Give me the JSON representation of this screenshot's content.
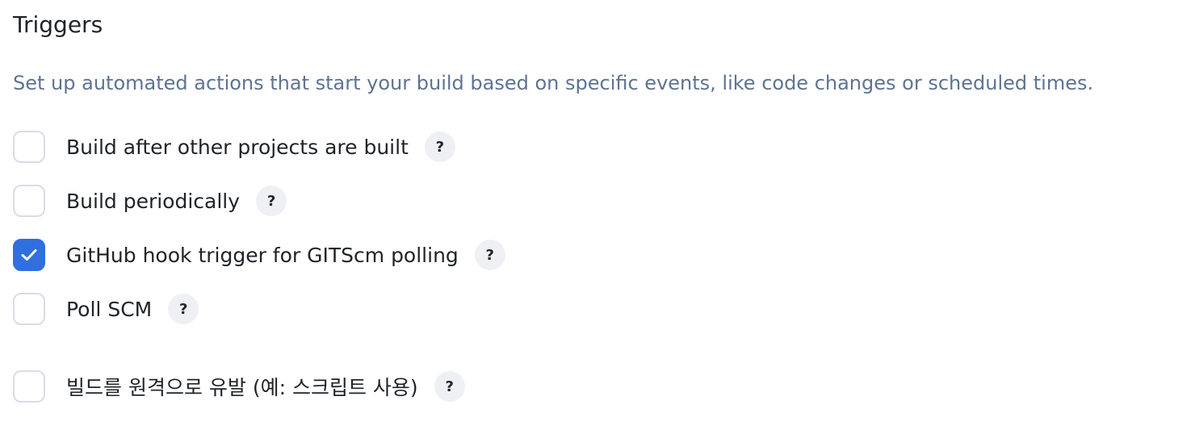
{
  "triggers": {
    "title": "Triggers",
    "description": "Set up automated actions that start your build based on specific events, like code changes or scheduled times.",
    "options": [
      {
        "label": "Build after other projects are built",
        "checked": false,
        "help": "?"
      },
      {
        "label": "Build periodically",
        "checked": false,
        "help": "?"
      },
      {
        "label": "GitHub hook trigger for GITScm polling",
        "checked": true,
        "help": "?"
      },
      {
        "label": "Poll SCM",
        "checked": false,
        "help": "?"
      },
      {
        "label": "빌드를 원격으로 유발 (예: 스크립트 사용)",
        "checked": false,
        "help": "?"
      }
    ]
  },
  "colors": {
    "accent": "#2f6fe0",
    "description_text": "#5f7393",
    "checkbox_border": "#d8dde6",
    "help_background": "#eef0f4"
  },
  "icons": {
    "check": "check-icon",
    "help": "question-mark"
  }
}
